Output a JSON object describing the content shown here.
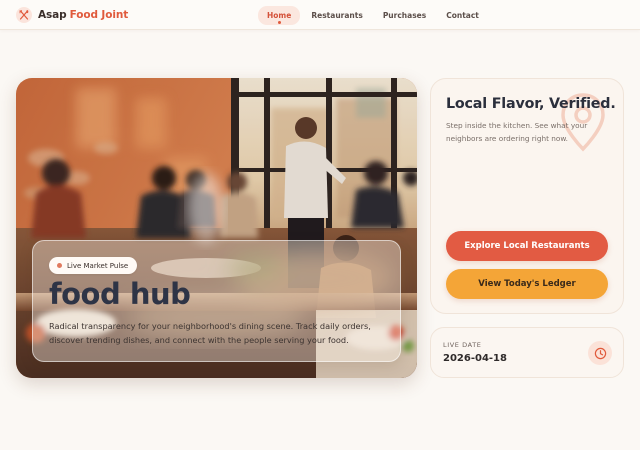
{
  "header": {
    "brand_part1": "Asap",
    "brand_part2": "Food Joint",
    "brand_icon": "utensils-icon",
    "nav": [
      {
        "label": "Home",
        "active": true
      },
      {
        "label": "Restaurants",
        "active": false
      },
      {
        "label": "Purchases",
        "active": false
      },
      {
        "label": "Contact",
        "active": false
      }
    ]
  },
  "hero": {
    "badge": "Live Market Pulse",
    "title": "food hub",
    "description": "Radical transparency for your neighborhood's dining scene. Track daily orders, discover trending dishes, and connect with the people serving your food."
  },
  "side_card": {
    "title": "Local Flavor, Verified.",
    "description": "Step inside the kitchen. See what your neighbors are ordering right now.",
    "watermark_icon": "map-pin-icon",
    "primary_button": "Explore Local Restaurants",
    "secondary_button": "View Today's Ledger"
  },
  "date_card": {
    "label": "LIVE DATE",
    "value": "2026-04-18",
    "icon": "clock-icon"
  },
  "colors": {
    "accent": "#e25b43",
    "secondary": "#f4a537",
    "background": "#fbf8f4",
    "title_dark": "#2e3446"
  }
}
